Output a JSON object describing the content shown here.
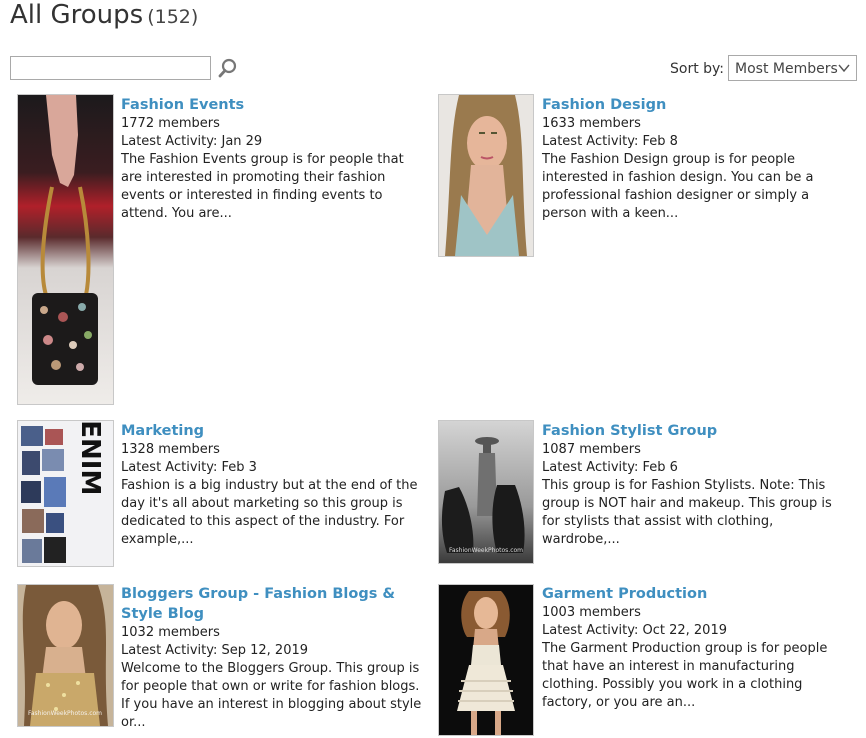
{
  "header": {
    "title": "All Groups",
    "count": "(152)"
  },
  "search": {
    "placeholder": ""
  },
  "sort": {
    "label": "Sort by:",
    "selected": "Most Members"
  },
  "groups": [
    {
      "name": "Fashion Events",
      "members": "1772 members",
      "activity": "Latest Activity: Jan 29",
      "description": "The Fashion Events group is for people that are interested in promoting their fashion events or interested in finding events to attend. You are..."
    },
    {
      "name": "Fashion Design",
      "members": "1633 members",
      "activity": "Latest Activity: Feb 8",
      "description": "The Fashion Design group is for people interested in fashion design. You can be a professional fashion designer or simply a person with a keen..."
    },
    {
      "name": "Marketing",
      "members": "1328 members",
      "activity": "Latest Activity: Feb 3",
      "description": "Fashion is a big industry but at the end of the day it's all about marketing so this group is dedicated to this aspect of the industry. For example,..."
    },
    {
      "name": "Fashion Stylist Group",
      "members": "1087 members",
      "activity": "Latest Activity: Feb 6",
      "description": "This group is for Fashion Stylists. Note: This group is NOT hair and makeup. This group is for stylists that assist with clothing, wardrobe,..."
    },
    {
      "name": "Bloggers Group - Fashion Blogs & Style Blog",
      "members": "1032 members",
      "activity": "Latest Activity: Sep 12, 2019",
      "description": "Welcome to the Bloggers Group. This group is for people that own or write for fashion blogs. If you have an interest in blogging about style or..."
    },
    {
      "name": "Garment Production",
      "members": "1003 members",
      "activity": "Latest Activity: Oct 22, 2019",
      "description": "The Garment Production group is for people that have an interest in manufacturing clothing. Possibly you work in a clothing factory, or you are an..."
    }
  ],
  "thumbnails": {
    "denim_letters": "DENIM",
    "stylist_caption": "FashionWeekPhotos.com",
    "blogger_caption": "FashionWeekPhotos.com"
  },
  "colors": {
    "link": "#3f8fc0",
    "border": "#c8c8c8"
  }
}
